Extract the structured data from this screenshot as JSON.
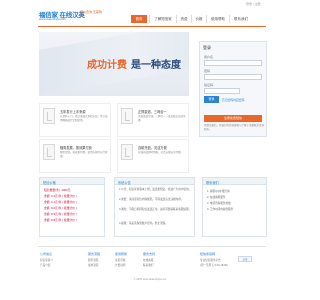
{
  "toplinks": "登录 | 注册",
  "logo": {
    "main": "福信家 在线汉英",
    "sub": "www.duanxinjia.com",
    "slogan": "低价查询 无需购买"
  },
  "nav": [
    "首页",
    "了解短信家",
    "资费",
    "价格",
    "使用帮助",
    "联系我们"
  ],
  "banner": {
    "part1": "成功计费",
    "part2": "是一种态度"
  },
  "login": {
    "title": "登录",
    "user_label": "用户名",
    "pass_label": "密码",
    "code_label": "验证码",
    "button": "登录",
    "remember": "忘记密码找回密码",
    "register": "注册免费短信",
    "note": "免费注册后，有疑问可咨询客服与了解上余额联系查询服务。"
  },
  "features": [
    {
      "title": "五年发行上手来源",
      "desc": "从资料入门，经过发展计划和方案。可以使用网络进行定制使用。"
    },
    {
      "title": "正规渠道，三网合一",
      "desc": "正规渠道专线，三网合一，发送稳定高效可靠。"
    },
    {
      "title": "随需发展，按效果付费",
      "desc": "随需定制，按效果付费，使用方便可自行管理。"
    },
    {
      "title": "自助充值，灵活方便",
      "desc": "在线充值即时到账，灵活方便安全可靠。"
    }
  ],
  "pricing": {
    "title": "短信价格",
    "rows": [
      "短信数量(条): 1000元",
      "金额: 9.2元/条 ( 按量计价 )",
      "金额: 9.1元/条 ( 按量计价 )",
      "金额: 9.0元/条 ( 按量计价 )",
      "金额: 8.9元/条 ( 按量计价 )",
      "金额: 8.8元/条 ( 按量计价 )"
    ]
  },
  "notice": {
    "title": "系统公告",
    "items": [
      "1.公告：短信家新版本上线，发送更稳定，欢迎广大用户使用。",
      "2.重要：请注意短信内容规范，不得发送违法违规内容。",
      "3.通知：节假日期间短信发送正常，如有问题请联系客服处理。",
      "4.提醒：请妥善保管账户密码，防止泄露。"
    ]
  },
  "contact": {
    "title": "联系我们",
    "items": [
      "1. 客服QQ在线咨询",
      "2. 在线客服服务",
      "3. 电话咨询服务热线",
      "4. 工作时间内提供服务"
    ]
  },
  "footer": {
    "columns": [
      {
        "title": "公司信息",
        "links": [
          "短信家简介",
          "产品介绍"
        ]
      },
      {
        "title": "服务流程",
        "links": [
          "服务流程",
          "使用流程"
        ]
      },
      {
        "title": "使用帮助",
        "links": [
          "常见问题",
          "计费说明"
        ]
      },
      {
        "title": "服务支持",
        "links": [
          "在线客服",
          "联系我们"
        ]
      }
    ],
    "info_title": "短信家官网",
    "info_lines": [
      "专业短信服务平台",
      "(周一至周五 9:00-18:00)"
    ],
    "badge": "认证",
    "copyright": "© 2015  www.duanxinjia.com"
  }
}
